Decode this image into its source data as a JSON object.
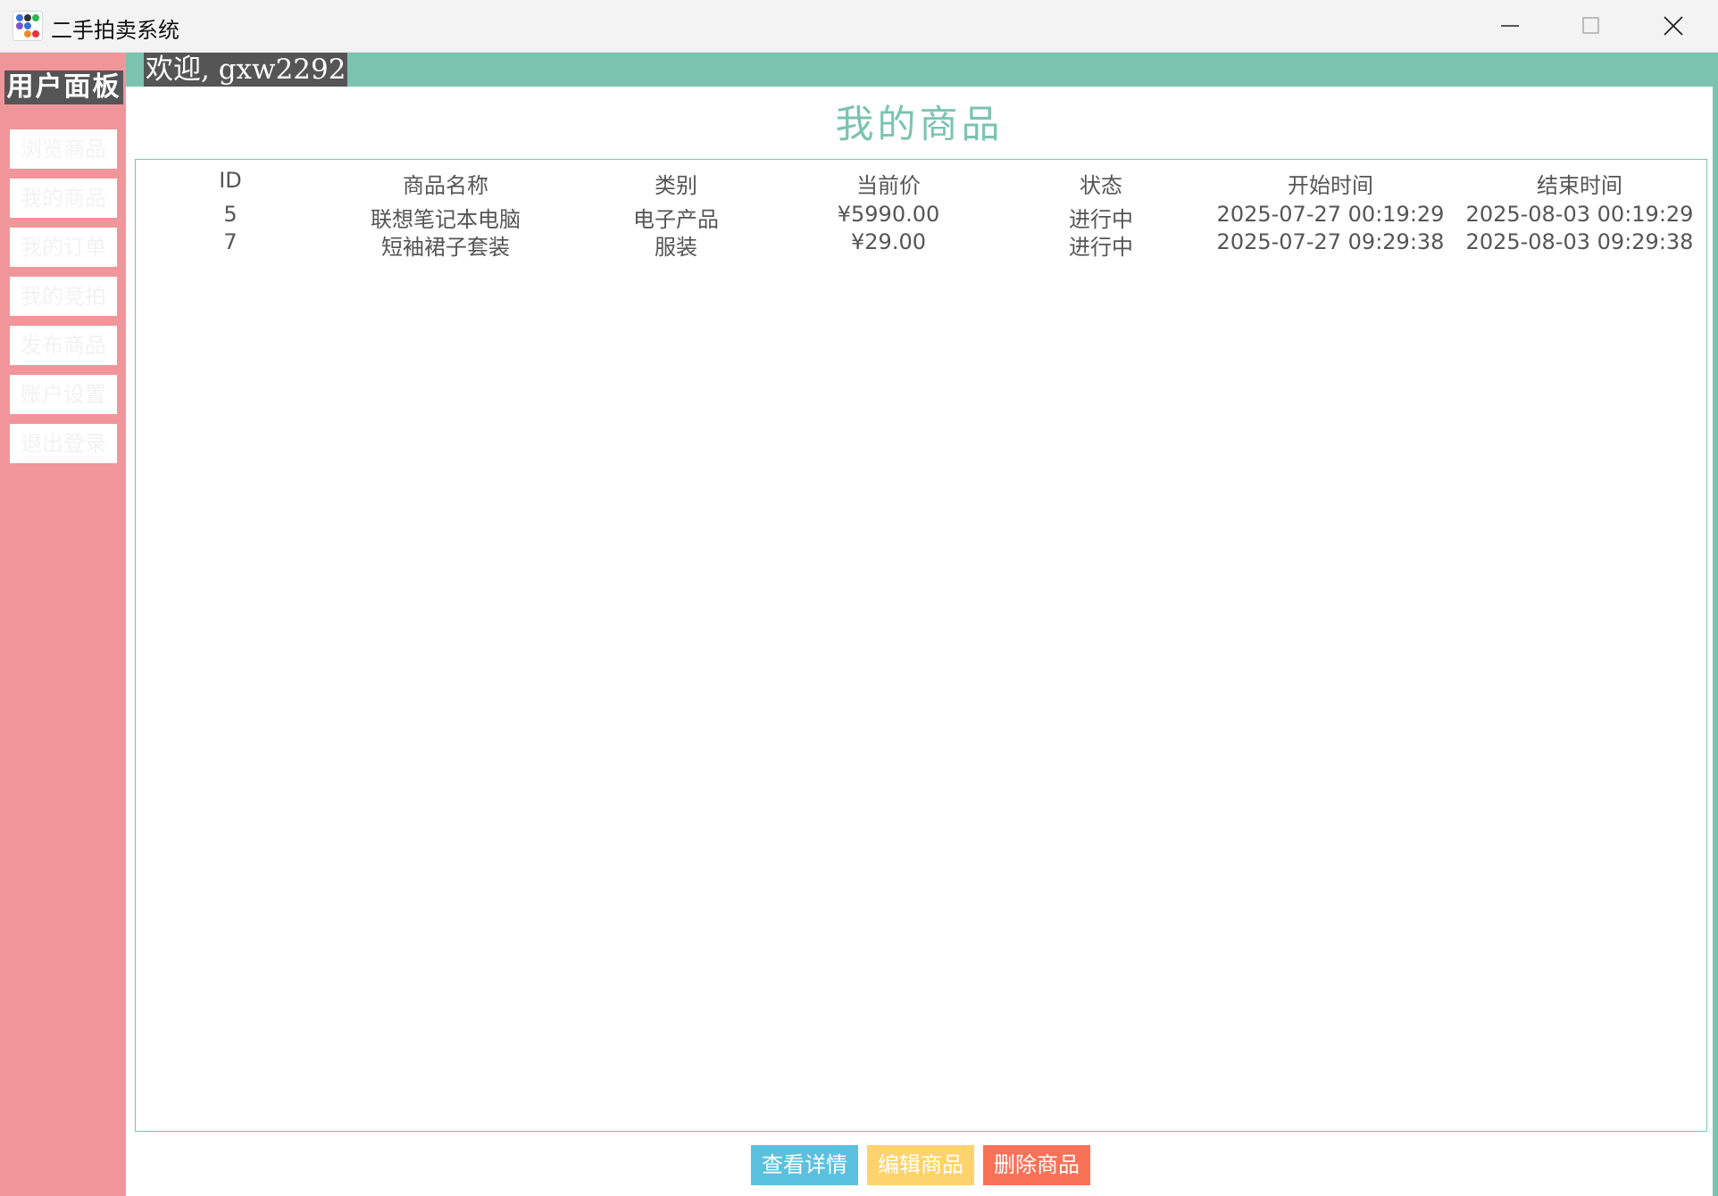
{
  "window": {
    "title": "二手拍卖系统"
  },
  "sidebar": {
    "title": "用户面板",
    "items": [
      {
        "label": "浏览商品"
      },
      {
        "label": "我的商品"
      },
      {
        "label": "我的订单"
      },
      {
        "label": "我的竞拍"
      },
      {
        "label": "发布商品"
      },
      {
        "label": "账户设置"
      },
      {
        "label": "退出登录"
      }
    ]
  },
  "header": {
    "welcome": "欢迎, gxw2292"
  },
  "main": {
    "title": "我的商品",
    "table": {
      "columns": [
        "ID",
        "商品名称",
        "类别",
        "当前价",
        "状态",
        "开始时间",
        "结束时间"
      ],
      "rows": [
        [
          "5",
          "联想笔记本电脑",
          "电子产品",
          "¥5990.00",
          "进行中",
          "2025-07-27 00:19:29",
          "2025-08-03 00:19:29"
        ],
        [
          "7",
          "短袖裙子套装",
          "服装",
          "¥29.00",
          "进行中",
          "2025-07-27 09:29:38",
          "2025-08-03 09:29:38"
        ]
      ]
    }
  },
  "actions": {
    "view_label": "查看详情",
    "edit_label": "编辑商品",
    "delete_label": "删除商品"
  },
  "colors": {
    "accent": "#7bc3ae",
    "sidebar": "#f0969b",
    "view": "#5bc0de",
    "edit": "#ffd36b",
    "delete": "#f97157",
    "text": "#555555"
  },
  "icons": {
    "app": "app-icon",
    "minimize": "minimize-icon",
    "maximize": "maximize-icon",
    "close": "close-icon"
  }
}
